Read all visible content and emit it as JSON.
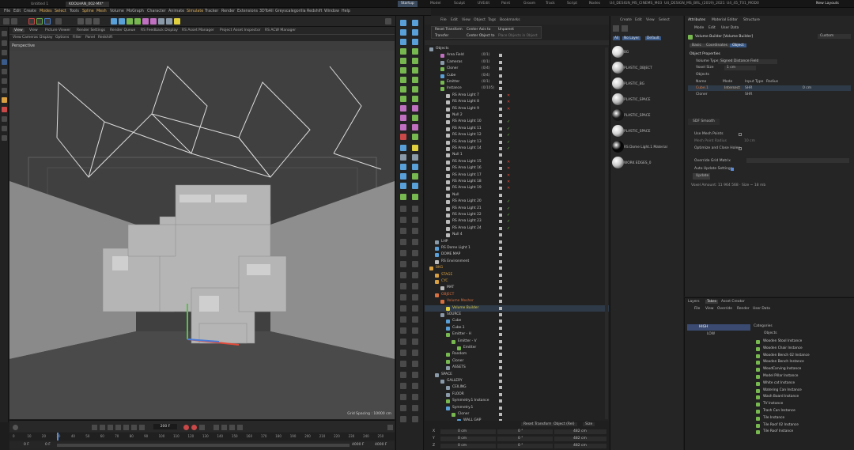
{
  "window_tabs": [
    "Untitled 1",
    "KOOLHAN_002-MX*"
  ],
  "layout_tabs": [
    "Startup",
    "Model",
    "Sculpt",
    "UVEdit",
    "Paint",
    "Groom",
    "Track",
    "Script",
    "Nodes",
    "U4_DESIGN_MS_CINEMS_M03",
    "U4_DESIGN_MS_BRL_(2019)_2021",
    "U4_45_T01_MOD0",
    "New Layouts"
  ],
  "main_menu": [
    "File",
    "Edit",
    "Create",
    "Modes",
    "Select",
    "Tools",
    "Spline",
    "Mesh",
    "Volume",
    "MoGraph",
    "Character",
    "Animate",
    "Simulate",
    "Tracker",
    "Render",
    "Extensions",
    "3DToAll",
    "Greyscalegorilla",
    "Redshift",
    "Window",
    "Help"
  ],
  "viewport": {
    "menu": [
      "View",
      "Cameras",
      "Display",
      "Options",
      "Filter",
      "Panel",
      "Redshift"
    ],
    "tabs": [
      "View",
      "Picture Viewer",
      "Render Settings",
      "Render Queue",
      "RS Feedback Display",
      "RS Asset Manager",
      "Project Asset Inspector",
      "RS ACW Manager"
    ],
    "camera_label": "Perspective",
    "grid_spacing": "Grid Spacing : 10000 cm"
  },
  "timeline": {
    "frame_value": "200 F",
    "start": "0 F",
    "start2": "0 F",
    "end": "4000 F",
    "end2": "4000 F",
    "ticks": [
      "0",
      "10",
      "20",
      "30",
      "40",
      "50",
      "60",
      "70",
      "80",
      "90",
      "100",
      "110",
      "120",
      "130",
      "140",
      "150",
      "160",
      "170",
      "180",
      "190",
      "200",
      "210",
      "220",
      "230",
      "240",
      "250"
    ]
  },
  "object_manager": {
    "menu": [
      "File",
      "Edit",
      "View",
      "Object",
      "Tags",
      "Bookmarks"
    ],
    "popup": [
      "Reset Transform",
      "Center Axis to",
      "Unparent",
      "Transfer",
      "Center Object to",
      "Place Objects in Object"
    ],
    "header": "Objects",
    "rows": [
      {
        "indent": 0,
        "name": "Objects",
        "color": "#c8c8c8",
        "icon": "#8a9aa8",
        "status": ""
      },
      {
        "indent": 2,
        "name": "Area Field",
        "color": "#c8c8c8",
        "icon": "#c070c0",
        "status": "(0/1)"
      },
      {
        "indent": 2,
        "name": "Cameras",
        "color": "#c8c8c8",
        "icon": "#8a9aa8",
        "status": "(0/1)"
      },
      {
        "indent": 2,
        "name": "Cloner",
        "color": "#c8c8c8",
        "icon": "#78b850",
        "status": "(0/4)"
      },
      {
        "indent": 2,
        "name": "Cube",
        "color": "#c8c8c8",
        "icon": "#5aa0d8",
        "status": "(0/4)"
      },
      {
        "indent": 2,
        "name": "Emitter",
        "color": "#c8c8c8",
        "icon": "#78b850",
        "status": "(0/1)"
      },
      {
        "indent": 2,
        "name": "Instance",
        "color": "#c8c8c8",
        "icon": "#78b850",
        "status": "(0/105)"
      },
      {
        "indent": 3,
        "name": "RS Area Light 7",
        "color": "#c8c8c8",
        "icon": "#bbbbbb",
        "status": "x"
      },
      {
        "indent": 3,
        "name": "RS Area Light 8",
        "color": "#c8c8c8",
        "icon": "#bbbbbb",
        "status": "x"
      },
      {
        "indent": 3,
        "name": "RS Area Light 9",
        "color": "#c8c8c8",
        "icon": "#bbbbbb",
        "status": "x"
      },
      {
        "indent": 3,
        "name": "Null 2",
        "color": "#c8c8c8",
        "icon": "#bbbbbb",
        "status": ""
      },
      {
        "indent": 3,
        "name": "RS Area Light 10",
        "color": "#c8c8c8",
        "icon": "#bbbbbb",
        "status": "v"
      },
      {
        "indent": 3,
        "name": "RS Area Light 11",
        "color": "#c8c8c8",
        "icon": "#bbbbbb",
        "status": "v"
      },
      {
        "indent": 3,
        "name": "RS Area Light 12",
        "color": "#c8c8c8",
        "icon": "#bbbbbb",
        "status": "v"
      },
      {
        "indent": 3,
        "name": "RS Area Light 13",
        "color": "#c8c8c8",
        "icon": "#bbbbbb",
        "status": "v"
      },
      {
        "indent": 3,
        "name": "RS Area Light 14",
        "color": "#c8c8c8",
        "icon": "#bbbbbb",
        "status": "v"
      },
      {
        "indent": 3,
        "name": "Null 1",
        "color": "#c8c8c8",
        "icon": "#bbbbbb",
        "status": ""
      },
      {
        "indent": 3,
        "name": "RS Area Light 15",
        "color": "#c8c8c8",
        "icon": "#bbbbbb",
        "status": "x"
      },
      {
        "indent": 3,
        "name": "RS Area Light 16",
        "color": "#c8c8c8",
        "icon": "#bbbbbb",
        "status": "x"
      },
      {
        "indent": 3,
        "name": "RS Area Light 17",
        "color": "#c8c8c8",
        "icon": "#bbbbbb",
        "status": "x"
      },
      {
        "indent": 3,
        "name": "RS Area Light 18",
        "color": "#c8c8c8",
        "icon": "#bbbbbb",
        "status": "x"
      },
      {
        "indent": 3,
        "name": "RS Area Light 19",
        "color": "#c8c8c8",
        "icon": "#bbbbbb",
        "status": "x"
      },
      {
        "indent": 3,
        "name": "Null",
        "color": "#c8c8c8",
        "icon": "#bbbbbb",
        "status": ""
      },
      {
        "indent": 3,
        "name": "RS Area Light 20",
        "color": "#c8c8c8",
        "icon": "#bbbbbb",
        "status": "v"
      },
      {
        "indent": 3,
        "name": "RS Area Light 21",
        "color": "#c8c8c8",
        "icon": "#bbbbbb",
        "status": "v"
      },
      {
        "indent": 3,
        "name": "RS Area Light 22",
        "color": "#c8c8c8",
        "icon": "#bbbbbb",
        "status": "v"
      },
      {
        "indent": 3,
        "name": "RS Area Light 23",
        "color": "#c8c8c8",
        "icon": "#bbbbbb",
        "status": "v"
      },
      {
        "indent": 3,
        "name": "RS Area Light 24",
        "color": "#c8c8c8",
        "icon": "#bbbbbb",
        "status": "v"
      },
      {
        "indent": 3,
        "name": "Null 4",
        "color": "#c8c8c8",
        "icon": "#bbbbbb",
        "status": ""
      },
      {
        "indent": 1,
        "name": "LHP",
        "color": "#c8c8c8",
        "icon": "#8a9aa8",
        "status": ""
      },
      {
        "indent": 1,
        "name": "RS Dome Light 1",
        "color": "#c8c8c8",
        "icon": "#5aa0d8",
        "status": ""
      },
      {
        "indent": 1,
        "name": "DOME MAP",
        "color": "#c8c8c8",
        "icon": "#5aa0d8",
        "status": ""
      },
      {
        "indent": 1,
        "name": "RS Environment",
        "color": "#c8c8c8",
        "icon": "#bbbbbb",
        "status": ""
      },
      {
        "indent": 0,
        "name": "BKG",
        "color": "#d8a040",
        "icon": "#d8a040",
        "status": ""
      },
      {
        "indent": 1,
        "name": "STAGE",
        "color": "#d8a040",
        "icon": "#d8a040",
        "status": ""
      },
      {
        "indent": 1,
        "name": "CYC",
        "color": "#d8a040",
        "icon": "#d8a040",
        "status": ""
      },
      {
        "indent": 2,
        "name": "MAT",
        "color": "#c8c8c8",
        "icon": "#bbbbbb",
        "status": ""
      },
      {
        "indent": 1,
        "name": "OBJECT",
        "color": "#d87040",
        "icon": "#d87040",
        "status": ""
      },
      {
        "indent": 2,
        "name": "Volume Mesher",
        "color": "#d87040",
        "icon": "#d87040",
        "status": ""
      },
      {
        "indent": 3,
        "name": "Volume Builder",
        "color": "#e0d040",
        "icon": "#e0d040",
        "status": ""
      },
      {
        "indent": 2,
        "name": "SOURCE",
        "color": "#c8c8c8",
        "icon": "#8a9aa8",
        "status": ""
      },
      {
        "indent": 3,
        "name": "Cube",
        "color": "#c8c8c8",
        "icon": "#5aa0d8",
        "status": ""
      },
      {
        "indent": 3,
        "name": "Cube.1",
        "color": "#c8c8c8",
        "icon": "#5aa0d8",
        "status": ""
      },
      {
        "indent": 3,
        "name": "Emitter - H",
        "color": "#c8c8c8",
        "icon": "#78b850",
        "status": ""
      },
      {
        "indent": 4,
        "name": "Emitter - V",
        "color": "#c8c8c8",
        "icon": "#78b850",
        "status": ""
      },
      {
        "indent": 5,
        "name": "Emitter",
        "color": "#c8c8c8",
        "icon": "#78b850",
        "status": ""
      },
      {
        "indent": 3,
        "name": "Random",
        "color": "#c8c8c8",
        "icon": "#78b850",
        "status": ""
      },
      {
        "indent": 3,
        "name": "Cloner",
        "color": "#c8c8c8",
        "icon": "#78b850",
        "status": ""
      },
      {
        "indent": 3,
        "name": "ASSETS",
        "color": "#c8c8c8",
        "icon": "#8a9aa8",
        "status": ""
      },
      {
        "indent": 1,
        "name": "SPACE",
        "color": "#c8c8c8",
        "icon": "#8a9aa8",
        "status": ""
      },
      {
        "indent": 2,
        "name": "GALLERY",
        "color": "#c8c8c8",
        "icon": "#8a9aa8",
        "status": ""
      },
      {
        "indent": 3,
        "name": "CEILING",
        "color": "#c8c8c8",
        "icon": "#8a9aa8",
        "status": ""
      },
      {
        "indent": 3,
        "name": "FLOOR",
        "color": "#c8c8c8",
        "icon": "#8a9aa8",
        "status": ""
      },
      {
        "indent": 3,
        "name": "Symmetry.1 Instance",
        "color": "#c8c8c8",
        "icon": "#78b850",
        "status": ""
      },
      {
        "indent": 3,
        "name": "Symmetry.1",
        "color": "#c8c8c8",
        "icon": "#5aa0d8",
        "status": ""
      },
      {
        "indent": 4,
        "name": "Cloner",
        "color": "#c8c8c8",
        "icon": "#78b850",
        "status": ""
      },
      {
        "indent": 5,
        "name": "WALL GAP",
        "color": "#c8c8c8",
        "icon": "#5aa0d8",
        "status": ""
      }
    ],
    "coord_header": [
      "Reset Transform",
      "Object (Rel)",
      "Size"
    ],
    "coord_rows": [
      {
        "axis": "X",
        "pos": "0 cm",
        "rot": "0 °",
        "size": "482 cm"
      },
      {
        "axis": "Y",
        "pos": "0 cm",
        "rot": "0 °",
        "size": "482 cm"
      },
      {
        "axis": "Z",
        "pos": "0 cm",
        "rot": "0 °",
        "size": "482 cm"
      }
    ]
  },
  "material_manager": {
    "menu": [
      "Create",
      "Edit",
      "View",
      "Select"
    ],
    "filters": [
      "All",
      "No Layer",
      "Default"
    ],
    "materials": [
      {
        "name": "BG",
        "color": "#d8d8d8"
      },
      {
        "name": "PLASTIC_OBJECT",
        "color": "#c0c0c0"
      },
      {
        "name": "PLASTIC_BG",
        "color": "#cccccc"
      },
      {
        "name": "PLASTIC_SPACE",
        "color": "#b8b8b8"
      },
      {
        "name": "PLASTIC_SPACE",
        "color": "#1a1a1a"
      },
      {
        "name": "PLASTIC_SPACE",
        "color": "#d0d0d0"
      },
      {
        "name": "RS Dome Light.1 Material",
        "color": "#050505"
      },
      {
        "name": "WORK EDGES_0",
        "color": "#c8c8c8"
      }
    ]
  },
  "attributes": {
    "tabs": [
      "Attributes",
      "Material Editor",
      "Structure"
    ],
    "menu": [
      "Mode",
      "Edit",
      "User Data"
    ],
    "object_title": "Volume Builder [Volume Builder]",
    "preset": "Custom",
    "subtabs": [
      "Basic",
      "Coordinates",
      "Object"
    ],
    "section": "Object Properties",
    "volume_type_label": "Volume Type",
    "volume_type": "Signed Distance Field",
    "voxel_size_label": "Voxel Size",
    "voxel_size": "1 cm",
    "objects_label": "Objects",
    "table_headers": [
      "Name",
      "Mode",
      "Input Type",
      "Radius"
    ],
    "table_rows": [
      {
        "name": "Cube.1",
        "mode": "Intersect",
        "input": "SHR",
        "radius": "0 cm"
      },
      {
        "name": "Cloner",
        "mode": "",
        "input": "SHR",
        "radius": ""
      }
    ],
    "sdf_section": "SDF Smooth",
    "use_mesh_points": "Use Mesh Points",
    "mesh_point_radius": "Mesh Point Radius",
    "mesh_point_radius_value": "10 cm",
    "optimize": "Optimize and Close Holes",
    "override_grid": "Override Grid Matrix",
    "auto_update": "Auto Update Settings",
    "update_btn": "Update",
    "voxel_amount": "Voxel Amount: 11 964 568 · Size ~ 18 mb"
  },
  "layers": {
    "tabs": [
      "Layers",
      "Takes",
      "Asset Creator"
    ],
    "menu": [
      "File",
      "View",
      "Override",
      "Render",
      "User Data"
    ],
    "takes": [
      "HIGH",
      "LOW"
    ],
    "categories_label": "Categories",
    "objects_label": "Objects",
    "items": [
      "Wooden Stool Instance",
      "Wooden Chair Instance",
      "Wooden Bench 02 Instance",
      "Wooden Bench Instance",
      "WoodCarving Instance",
      "Model Pillar Instance",
      "White cat Instance",
      "Watering Can Instance",
      "Wash Board Instance",
      "TV Instance",
      "Trash Can Instance",
      "Tile Instance",
      "Tile Roof 02 Instance",
      "Tile Roof Instance"
    ]
  }
}
